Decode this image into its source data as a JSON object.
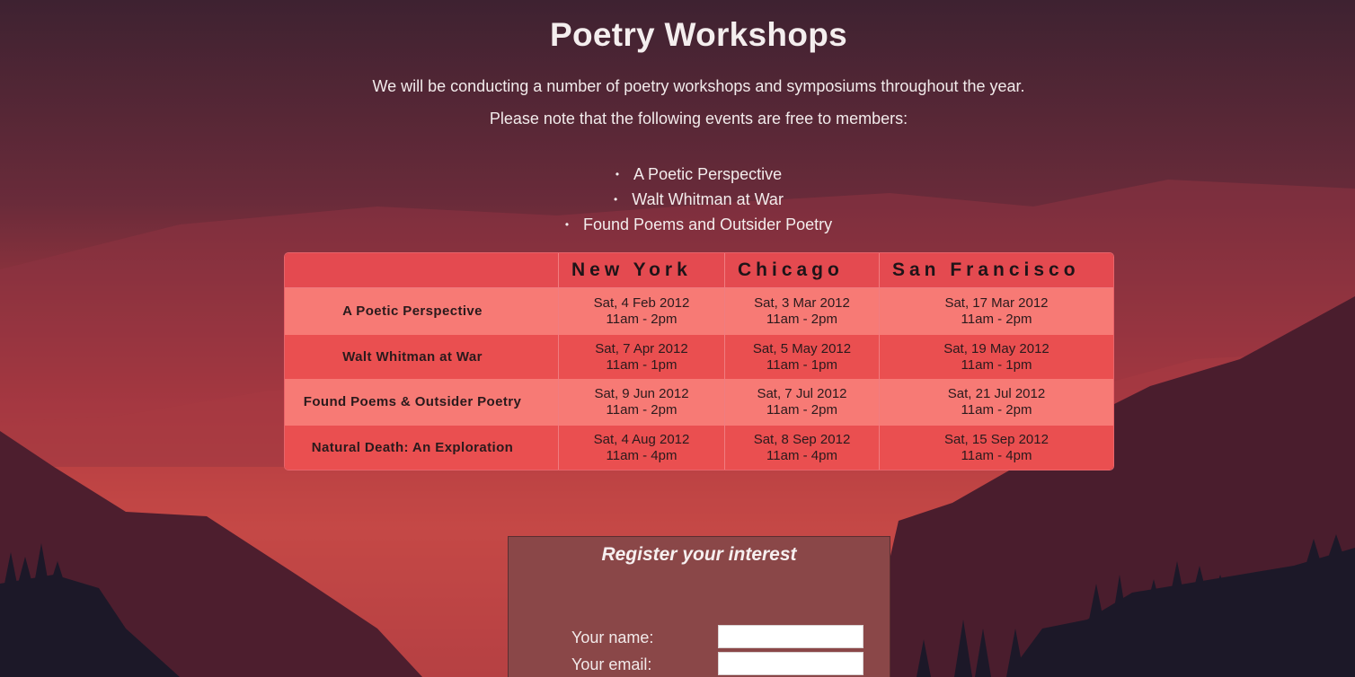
{
  "page": {
    "title": "Poetry Workshops",
    "intro_line1": "We will be conducting a number of poetry workshops and symposiums throughout the year.",
    "intro_line2": "Please note that the following events are free to members:"
  },
  "events": [
    "A Poetic Perspective",
    "Walt Whitman at War",
    "Found Poems and Outsider Poetry"
  ],
  "schedule": {
    "headers": [
      "",
      "New York",
      "Chicago",
      "San Francisco"
    ],
    "rows": [
      {
        "name": "A Poetic Perspective",
        "cells": [
          {
            "date": "Sat, 4 Feb 2012",
            "time": "11am - 2pm"
          },
          {
            "date": "Sat, 3 Mar 2012",
            "time": "11am - 2pm"
          },
          {
            "date": "Sat, 17 Mar 2012",
            "time": "11am - 2pm"
          }
        ]
      },
      {
        "name": "Walt Whitman at War",
        "cells": [
          {
            "date": "Sat, 7 Apr 2012",
            "time": "11am - 1pm"
          },
          {
            "date": "Sat, 5 May 2012",
            "time": "11am - 1pm"
          },
          {
            "date": "Sat, 19 May 2012",
            "time": "11am - 1pm"
          }
        ]
      },
      {
        "name": "Found Poems & Outsider Poetry",
        "cells": [
          {
            "date": "Sat, 9 Jun 2012",
            "time": "11am - 2pm"
          },
          {
            "date": "Sat, 7 Jul 2012",
            "time": "11am - 2pm"
          },
          {
            "date": "Sat, 21 Jul 2012",
            "time": "11am - 2pm"
          }
        ]
      },
      {
        "name": "Natural Death: An Exploration",
        "cells": [
          {
            "date": "Sat, 4 Aug 2012",
            "time": "11am - 4pm"
          },
          {
            "date": "Sat, 8 Sep 2012",
            "time": "11am - 4pm"
          },
          {
            "date": "Sat, 15 Sep 2012",
            "time": "11am - 4pm"
          }
        ]
      }
    ]
  },
  "form": {
    "heading": "Register your interest",
    "name_label": "Your name:",
    "name_value": "",
    "email_label": "Your email:",
    "email_value": ""
  },
  "colors": {
    "sky_top": "#3e2231",
    "sky_bottom": "#e85a4c",
    "table_header": "#e44a50",
    "row_light": "#f77a75",
    "row_dark": "#ea4f50",
    "form_bg": "#8a4748"
  }
}
